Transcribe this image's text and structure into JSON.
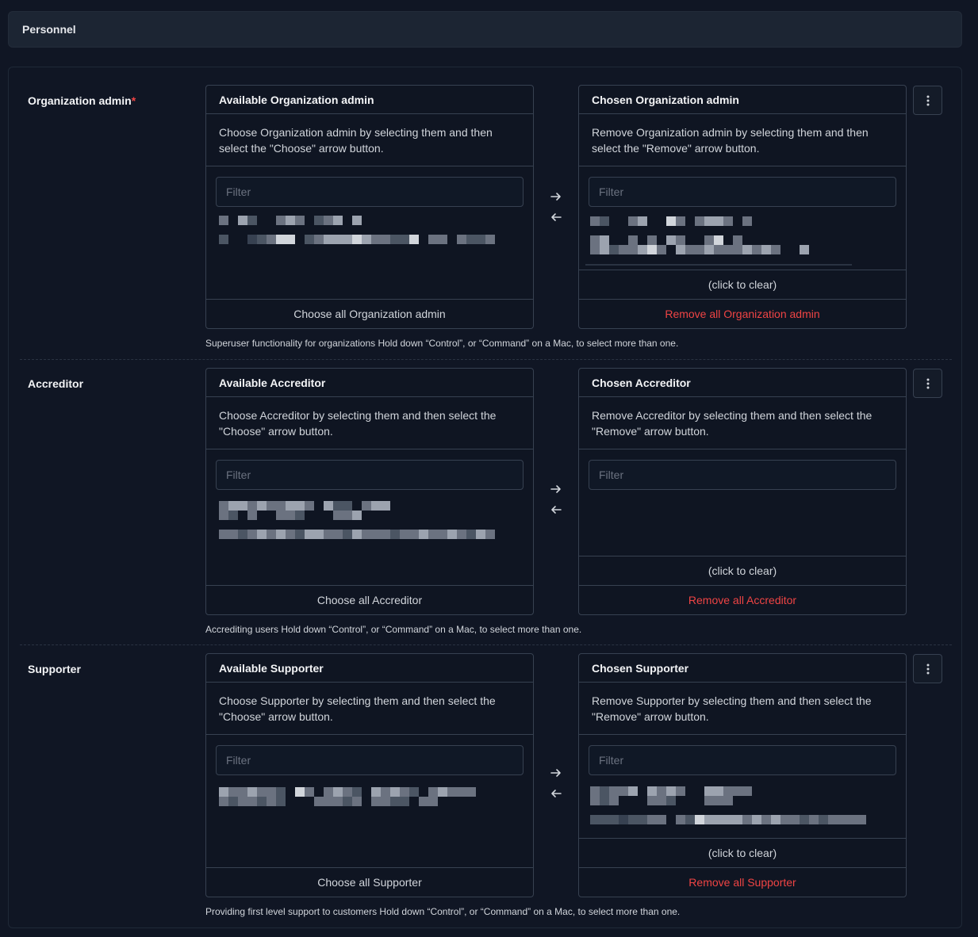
{
  "header": {
    "title": "Personnel"
  },
  "fields": [
    {
      "label": "Organization admin",
      "required": true,
      "available_title": "Available Organization admin",
      "available_help": "Choose Organization admin by selecting them and then select the \"Choose\" arrow button.",
      "filter_placeholder": "Filter",
      "choose_all": "Choose all Organization admin",
      "chosen_title": "Chosen Organization admin",
      "chosen_help": "Remove Organization admin by selecting them and then select the \"Remove\" arrow button.",
      "click_to_clear": "(click to clear)",
      "remove_all": "Remove all Organization admin",
      "help_text": "Superuser functionality for organizations Hold down “Control”, or “Command” on a Mac, to select more than one."
    },
    {
      "label": "Accreditor",
      "required": false,
      "available_title": "Available Accreditor",
      "available_help": "Choose Accreditor by selecting them and then select the \"Choose\" arrow button.",
      "filter_placeholder": "Filter",
      "choose_all": "Choose all Accreditor",
      "chosen_title": "Chosen Accreditor",
      "chosen_help": "Remove Accreditor by selecting them and then select the \"Remove\" arrow button.",
      "click_to_clear": "(click to clear)",
      "remove_all": "Remove all Accreditor",
      "help_text": "Accrediting users Hold down “Control”, or “Command” on a Mac, to select more than one."
    },
    {
      "label": "Supporter",
      "required": false,
      "available_title": "Available Supporter",
      "available_help": "Choose Supporter by selecting them and then select the \"Choose\" arrow button.",
      "filter_placeholder": "Filter",
      "choose_all": "Choose all Supporter",
      "chosen_title": "Chosen Supporter",
      "chosen_help": "Remove Supporter by selecting them and then select the \"Remove\" arrow button.",
      "click_to_clear": "(click to clear)",
      "remove_all": "Remove all Supporter",
      "help_text": "Providing first level support to customers Hold down “Control”, or “Command” on a Mac, to select more than one."
    }
  ],
  "icons": {
    "choose_arrow": "arrow-right-icon",
    "remove_arrow": "arrow-left-icon",
    "menu": "kebab-menu-icon"
  },
  "colors": {
    "background": "#101624",
    "header_bg": "#1c2533",
    "border": "#374151",
    "danger": "#ef4444"
  }
}
